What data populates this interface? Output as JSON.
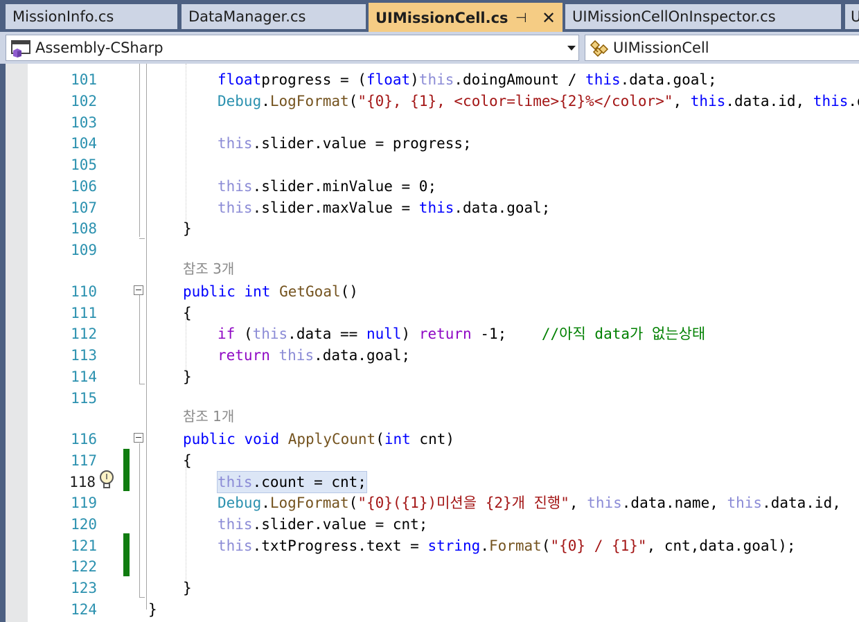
{
  "tabs": [
    {
      "label": "MissionInfo.cs",
      "active": false
    },
    {
      "label": "DataManager.cs",
      "active": false
    },
    {
      "label": "UIMissionCell.cs",
      "active": true
    },
    {
      "label": "UIMissionCellOnInspector.cs",
      "active": false
    },
    {
      "label": "U",
      "active": false
    }
  ],
  "tab_controls": {
    "pin": "⊣",
    "close": "✕"
  },
  "navbar": {
    "project": "Assembly-CSharp",
    "class": "UIMissionCell",
    "icons": [
      "csharp-project-icon",
      "class-icon"
    ]
  },
  "code_lens": {
    "refs_3": "참조 3개",
    "refs_1": "참조 1개"
  },
  "line_numbers": [
    "101",
    "102",
    "103",
    "104",
    "105",
    "106",
    "107",
    "108",
    "109",
    "110",
    "111",
    "112",
    "113",
    "114",
    "115",
    "116",
    "117",
    "118",
    "119",
    "120",
    "121",
    "122",
    "123",
    "124"
  ],
  "current_line": "118",
  "code": {
    "l101": [
      [
        "kw",
        "float"
      ],
      [
        "",
        "progress = ("
      ],
      [
        "kw",
        "float"
      ],
      [
        "",
        ")"
      ],
      [
        "th",
        "this"
      ],
      [
        "",
        ".doingAmount / "
      ],
      [
        "kw",
        "this"
      ],
      [
        "",
        ".data.goal;"
      ]
    ],
    "l102": [
      [
        "ty",
        "Debug"
      ],
      [
        "",
        "."
      ],
      [
        "me",
        "LogFormat"
      ],
      [
        "",
        "("
      ],
      [
        "st",
        "\"{0}, {1}, <color=lime>{2}%</color>\""
      ],
      [
        "",
        ", "
      ],
      [
        "kw",
        "this"
      ],
      [
        "",
        ".data.id, "
      ],
      [
        "kw",
        "this"
      ],
      [
        "",
        ".da"
      ]
    ],
    "l104": [
      [
        "th",
        "this"
      ],
      [
        "",
        ".slider.value = progress;"
      ]
    ],
    "l106": [
      [
        "th",
        "this"
      ],
      [
        "",
        ".slider.minValue = 0;"
      ]
    ],
    "l107": [
      [
        "th",
        "this"
      ],
      [
        "",
        ".slider.maxValue = "
      ],
      [
        "kw",
        "this"
      ],
      [
        "",
        ".data.goal;"
      ]
    ],
    "l108": [
      [
        "",
        "}"
      ]
    ],
    "l110": [
      [
        "kw",
        "public"
      ],
      [
        "",
        " "
      ],
      [
        "kw",
        "int"
      ],
      [
        "",
        " "
      ],
      [
        "me",
        "GetGoal"
      ],
      [
        "",
        "()"
      ]
    ],
    "l111": [
      [
        "",
        "{"
      ]
    ],
    "l112": [
      [
        "ctl",
        "if"
      ],
      [
        "",
        " ("
      ],
      [
        "th",
        "this"
      ],
      [
        "",
        ".data == "
      ],
      [
        "kw",
        "null"
      ],
      [
        "",
        ") "
      ],
      [
        "ctl",
        "return"
      ],
      [
        "",
        " -1;    "
      ],
      [
        "cm",
        "//아직 data가 없는상태"
      ]
    ],
    "l113": [
      [
        "ctl",
        "return"
      ],
      [
        "",
        " "
      ],
      [
        "th",
        "this"
      ],
      [
        "",
        ".data.goal;"
      ]
    ],
    "l114": [
      [
        "",
        "}"
      ]
    ],
    "l116": [
      [
        "kw",
        "public"
      ],
      [
        "",
        " "
      ],
      [
        "kw",
        "void"
      ],
      [
        "",
        " "
      ],
      [
        "me",
        "ApplyCount"
      ],
      [
        "",
        "("
      ],
      [
        "kw",
        "int"
      ],
      [
        "",
        " cnt)"
      ]
    ],
    "l117": [
      [
        "",
        "{"
      ]
    ],
    "l118": [
      [
        "th",
        "this"
      ],
      [
        "",
        ".count = cnt;"
      ]
    ],
    "l119": [
      [
        "ty",
        "Debug"
      ],
      [
        "",
        "."
      ],
      [
        "me",
        "LogFormat"
      ],
      [
        "",
        "("
      ],
      [
        "st",
        "\"{0}({1})미션을 {2}개 진행\""
      ],
      [
        "",
        ", "
      ],
      [
        "th",
        "this"
      ],
      [
        "",
        ".data.name, "
      ],
      [
        "th",
        "this"
      ],
      [
        "",
        ".data.id,"
      ]
    ],
    "l120": [
      [
        "th",
        "this"
      ],
      [
        "",
        ".slider.value = cnt;"
      ]
    ],
    "l121": [
      [
        "th",
        "this"
      ],
      [
        "",
        ".txtProgress.text = "
      ],
      [
        "kw",
        "string"
      ],
      [
        "",
        "."
      ],
      [
        "me",
        "Format"
      ],
      [
        "",
        "("
      ],
      [
        "st",
        "\"{0} / {1}\""
      ],
      [
        "",
        ", cnt,data.goal);"
      ]
    ],
    "l123": [
      [
        "",
        "}"
      ]
    ],
    "l124": [
      [
        "",
        "}"
      ]
    ]
  }
}
